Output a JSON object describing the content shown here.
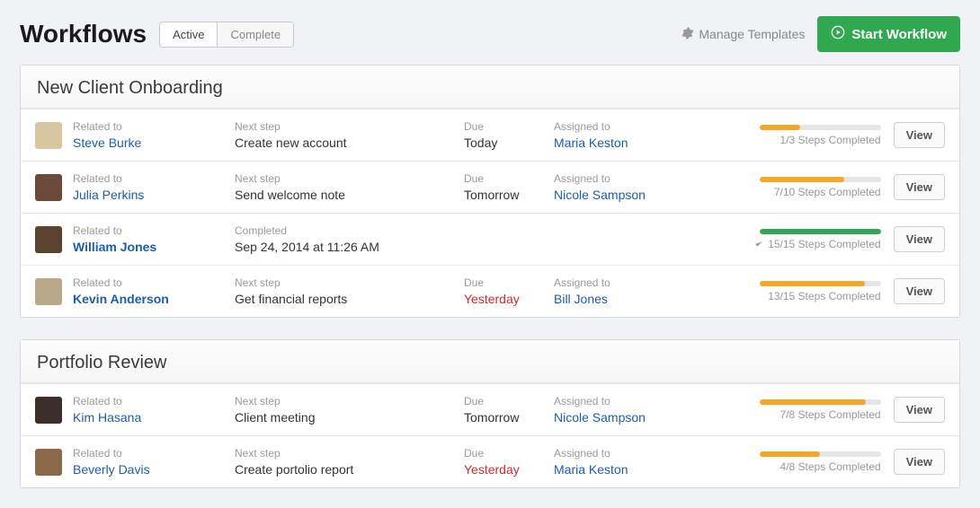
{
  "header": {
    "title": "Workflows",
    "tabs": [
      "Active",
      "Complete"
    ],
    "active_tab_index": 0,
    "manage_link": "Manage Templates",
    "start_button": "Start Workflow"
  },
  "labels": {
    "related_to": "Related to",
    "next_step": "Next step",
    "completed": "Completed",
    "due": "Due",
    "assigned_to": "Assigned to",
    "view": "View"
  },
  "colors": {
    "accent_green": "#2fa84f",
    "accent_orange": "#f5a623",
    "link_blue": "#1d5ea8",
    "overdue_red": "#cc2b2b"
  },
  "panels": [
    {
      "title": "New Client Onboarding",
      "rows": [
        {
          "avatar_color": "#d8c6a0",
          "person": "Steve Burke",
          "step_label": "Next step",
          "step_value": "Create new account",
          "due_label": "Due",
          "due_value": "Today",
          "due_overdue": false,
          "assigned_label": "Assigned to",
          "assigned": "Maria Keston",
          "progress_done": 1,
          "progress_total": 3,
          "progress_text": "1/3 Steps Completed",
          "complete": false
        },
        {
          "avatar_color": "#6b4a3a",
          "person": "Julia Perkins",
          "step_label": "Next step",
          "step_value": "Send welcome note",
          "due_label": "Due",
          "due_value": "Tomorrow",
          "due_overdue": false,
          "assigned_label": "Assigned to",
          "assigned": "Nicole Sampson",
          "progress_done": 7,
          "progress_total": 10,
          "progress_text": "7/10 Steps Completed",
          "complete": false
        },
        {
          "avatar_color": "#5a432f",
          "person": "William Jones",
          "step_label": "Completed",
          "step_value": "Sep 24, 2014 at 11:26 AM",
          "due_label": "",
          "due_value": "",
          "due_overdue": false,
          "assigned_label": "",
          "assigned": "",
          "progress_done": 15,
          "progress_total": 15,
          "progress_text": "15/15 Steps Completed",
          "complete": true,
          "bold": true
        },
        {
          "avatar_color": "#b9a88a",
          "person": "Kevin Anderson",
          "step_label": "Next step",
          "step_value": "Get financial reports",
          "due_label": "Due",
          "due_value": "Yesterday",
          "due_overdue": true,
          "assigned_label": "Assigned to",
          "assigned": "Bill Jones",
          "progress_done": 13,
          "progress_total": 15,
          "progress_text": "13/15 Steps Completed",
          "complete": false,
          "bold": true
        }
      ]
    },
    {
      "title": "Portfolio Review",
      "rows": [
        {
          "avatar_color": "#3a2f2a",
          "person": "Kim Hasana",
          "step_label": "Next step",
          "step_value": "Client meeting",
          "due_label": "Due",
          "due_value": "Tomorrow",
          "due_overdue": false,
          "assigned_label": "Assigned to",
          "assigned": "Nicole Sampson",
          "progress_done": 7,
          "progress_total": 8,
          "progress_text": "7/8 Steps Completed",
          "complete": false
        },
        {
          "avatar_color": "#8a6a4a",
          "person": "Beverly Davis",
          "step_label": "Next step",
          "step_value": "Create portolio report",
          "due_label": "Due",
          "due_value": "Yesterday",
          "due_overdue": true,
          "assigned_label": "Assigned to",
          "assigned": "Maria Keston",
          "progress_done": 4,
          "progress_total": 8,
          "progress_text": "4/8 Steps Completed",
          "complete": false
        }
      ]
    }
  ]
}
